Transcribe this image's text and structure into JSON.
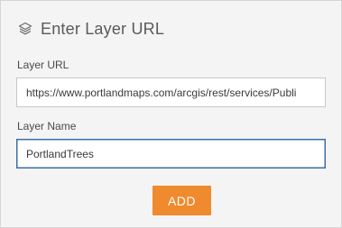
{
  "header": {
    "icon": "layers-icon",
    "title": "Enter Layer URL"
  },
  "form": {
    "url_label": "Layer URL",
    "url_value": "https://www.portlandmaps.com/arcgis/rest/services/Publi",
    "name_label": "Layer Name",
    "name_value": "PortlandTrees"
  },
  "actions": {
    "add_label": "ADD"
  },
  "colors": {
    "accent": "#f08a2e",
    "focus_border": "#3b6ea8",
    "panel_background": "#f4f4f4"
  }
}
